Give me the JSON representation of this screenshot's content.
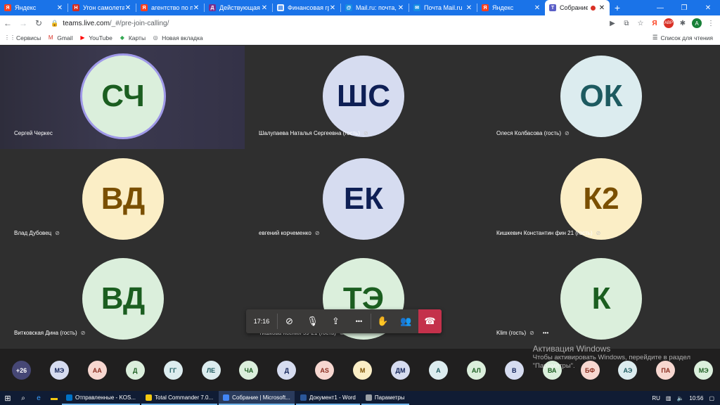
{
  "browser": {
    "tabs": [
      {
        "label": "Яндекс",
        "icon": "yandex-icon",
        "color": "#fc3f1d",
        "glyph": "Я"
      },
      {
        "label": "Угон самолета",
        "icon": "news-icon",
        "color": "#d52b1e",
        "glyph": "Н"
      },
      {
        "label": "агентство по п",
        "icon": "yandex-icon",
        "color": "#fc3f1d",
        "glyph": "Я"
      },
      {
        "label": "Действующая",
        "icon": "site-icon",
        "color": "#7b2d8e",
        "glyph": "Д"
      },
      {
        "label": "Финансовая гр",
        "icon": "doc-icon",
        "color": "#e8f0fe",
        "glyph": "▤"
      },
      {
        "label": "Mail.ru: почта,",
        "icon": "mailru-icon",
        "color": "#168de2",
        "glyph": "@"
      },
      {
        "label": "Почта Mail.ru",
        "icon": "mail-icon",
        "color": "#168de2",
        "glyph": "✉"
      },
      {
        "label": "Яндекс",
        "icon": "yandex-icon",
        "color": "#fc3f1d",
        "glyph": "Я"
      }
    ],
    "active_tab": {
      "label": "Собрание",
      "icon": "teams-icon"
    },
    "url_host": "teams.live.com",
    "url_path": "/_#/pre-join-calling/",
    "bookmarks": [
      {
        "label": "Сервисы",
        "icon": "apps-icon"
      },
      {
        "label": "Gmail",
        "icon": "gmail-icon"
      },
      {
        "label": "YouTube",
        "icon": "youtube-icon"
      },
      {
        "label": "Карты",
        "icon": "maps-icon"
      },
      {
        "label": "Новая вкладка",
        "icon": "globe-icon"
      }
    ],
    "reading_list": "Список для чтения",
    "profile_initial": "A"
  },
  "participants": [
    {
      "initials": "СЧ",
      "name": "Сергей Черкес",
      "muted": false,
      "bg": "#dbefdc",
      "fg": "#1b5e20",
      "speaking": true
    },
    {
      "initials": "ШС",
      "name": "Шалупаева Наталья Сергеевна (гость)",
      "muted": true,
      "bg": "#d6dcf0",
      "fg": "#0e1f55",
      "speaking": false
    },
    {
      "initials": "ОК",
      "name": "Олеся Колбасова (гость)",
      "muted": true,
      "bg": "#dcecef",
      "fg": "#1d5a60",
      "speaking": false
    },
    {
      "initials": "ВД",
      "name": "Влад Дубовец",
      "muted": true,
      "bg": "#fbeec6",
      "fg": "#7a4f00",
      "speaking": false
    },
    {
      "initials": "ЕК",
      "name": "евгений корчеменко",
      "muted": true,
      "bg": "#d6dcf0",
      "fg": "#0e1f55",
      "speaking": false
    },
    {
      "initials": "К2",
      "name": "Кишкевич Константин фин 21 (гость)",
      "muted": true,
      "bg": "#fbeec6",
      "fg": "#7a4f00",
      "speaking": false
    },
    {
      "initials": "ВД",
      "name": "Витковская Дина (гость)",
      "muted": true,
      "bg": "#dbefdc",
      "fg": "#1b5e20",
      "speaking": false
    },
    {
      "initials": "ТЭ",
      "name": "Тишкова Ксения 59-21 (гость)",
      "muted": true,
      "bg": "#dbefdc",
      "fg": "#1b5e20",
      "speaking": false
    },
    {
      "initials": "К",
      "name": "Klim (гость)",
      "muted": true,
      "bg": "#dbefdc",
      "fg": "#1b5e20",
      "speaking": false
    }
  ],
  "controls": {
    "timer": "17:16",
    "buttons": [
      {
        "name": "camera-off-button",
        "icon": "camera-off-icon",
        "glyph": "⊘"
      },
      {
        "name": "mic-button",
        "icon": "mic-icon",
        "glyph": "🎙"
      },
      {
        "name": "share-screen-button",
        "icon": "share-screen-icon",
        "glyph": "⇪"
      },
      {
        "name": "more-options-button",
        "icon": "more-icon",
        "glyph": "•••"
      },
      {
        "name": "raise-hand-button",
        "icon": "hand-icon",
        "glyph": "✋"
      },
      {
        "name": "participants-button",
        "icon": "people-icon",
        "glyph": "👥"
      }
    ],
    "hangup_glyph": "☎"
  },
  "roster": [
    {
      "initials": "+26",
      "bg": "#464775",
      "fg": "#ffffff"
    },
    {
      "initials": "МЭ",
      "bg": "#d6dcf0",
      "fg": "#0e1f55"
    },
    {
      "initials": "АА",
      "bg": "#f7d7d0",
      "fg": "#8a2d1f"
    },
    {
      "initials": "Д",
      "bg": "#dbefdc",
      "fg": "#1b5e20"
    },
    {
      "initials": "ГГ",
      "bg": "#dcecef",
      "fg": "#1d5a60"
    },
    {
      "initials": "ЛЕ",
      "bg": "#dcecef",
      "fg": "#1d5a60"
    },
    {
      "initials": "ЧА",
      "bg": "#dbefdc",
      "fg": "#1b5e20"
    },
    {
      "initials": "Д",
      "bg": "#d6dcf0",
      "fg": "#0e1f55"
    },
    {
      "initials": "AS",
      "bg": "#f7d7d0",
      "fg": "#8a2d1f"
    },
    {
      "initials": "М",
      "bg": "#fbeec6",
      "fg": "#7a4f00"
    },
    {
      "initials": "ДМ",
      "bg": "#d6dcf0",
      "fg": "#0e1f55"
    },
    {
      "initials": "А",
      "bg": "#dcecef",
      "fg": "#1d5a60"
    },
    {
      "initials": "АЛ",
      "bg": "#dbefdc",
      "fg": "#1b5e20"
    },
    {
      "initials": "В",
      "bg": "#d6dcf0",
      "fg": "#0e1f55"
    },
    {
      "initials": "ВА",
      "bg": "#dbefdc",
      "fg": "#1b5e20"
    },
    {
      "initials": "БФ",
      "bg": "#f7d7d0",
      "fg": "#8a2d1f"
    },
    {
      "initials": "АЭ",
      "bg": "#dcecef",
      "fg": "#1d5a60"
    },
    {
      "initials": "ПА",
      "bg": "#f7d7d0",
      "fg": "#8a2d1f"
    },
    {
      "initials": "МЭ",
      "bg": "#dbefdc",
      "fg": "#1b5e20"
    }
  ],
  "watermark": {
    "line1": "Активация Windows",
    "line2": "Чтобы активировать Windows, перейдите в раздел",
    "line3": "\"Параметры\"."
  },
  "taskbar": {
    "apps": [
      {
        "label": "Отправленные - KOS...",
        "color": "#0072c6",
        "active": false
      },
      {
        "label": "Total Commander 7.0...",
        "color": "#f2c811",
        "active": false
      },
      {
        "label": "Собрание | Microsoft...",
        "color": "#4285f4",
        "active": true
      },
      {
        "label": "Документ1 - Word",
        "color": "#2b579a",
        "active": false
      },
      {
        "label": "Параметры",
        "color": "#9aa0a6",
        "active": false
      }
    ],
    "lang": "RU",
    "time": "10:56"
  }
}
